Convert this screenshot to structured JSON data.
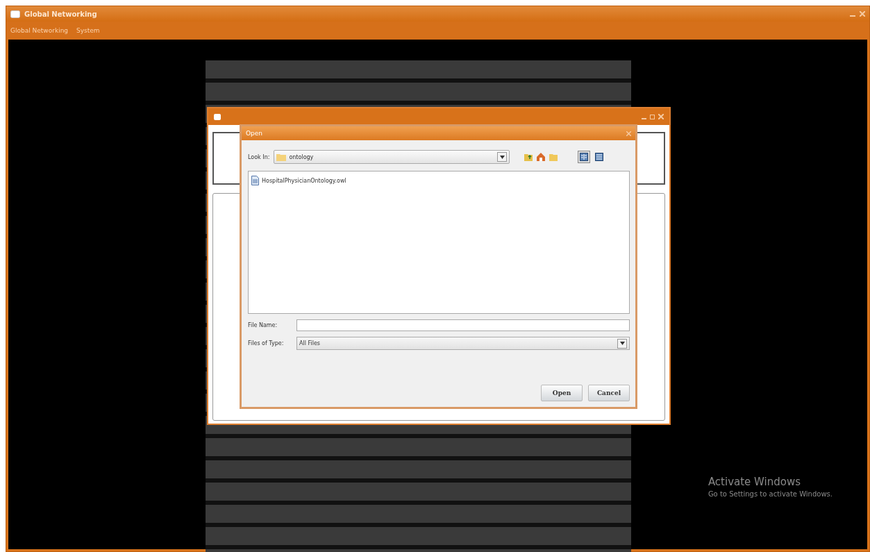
{
  "app_window": {
    "title": "Global Networking",
    "menu": [
      "Global Networking",
      "System"
    ]
  },
  "open_dialog": {
    "title": "Open",
    "look_in": {
      "label": "Look In:",
      "value": "ontology"
    },
    "view_modes": [
      {
        "selected": true
      },
      {
        "selected": false
      }
    ],
    "files": [
      {
        "name": "HospitalPhysicianOntology.owl"
      }
    ],
    "file_name": {
      "label": "File Name:"
    },
    "files_of_type": {
      "label": "Files of Type:",
      "value": "All Files"
    },
    "buttons": [
      "Open",
      "Cancel"
    ]
  },
  "activation_notice": {
    "title": "Activate Windows",
    "text": "Go to Settings to activate Windows."
  }
}
